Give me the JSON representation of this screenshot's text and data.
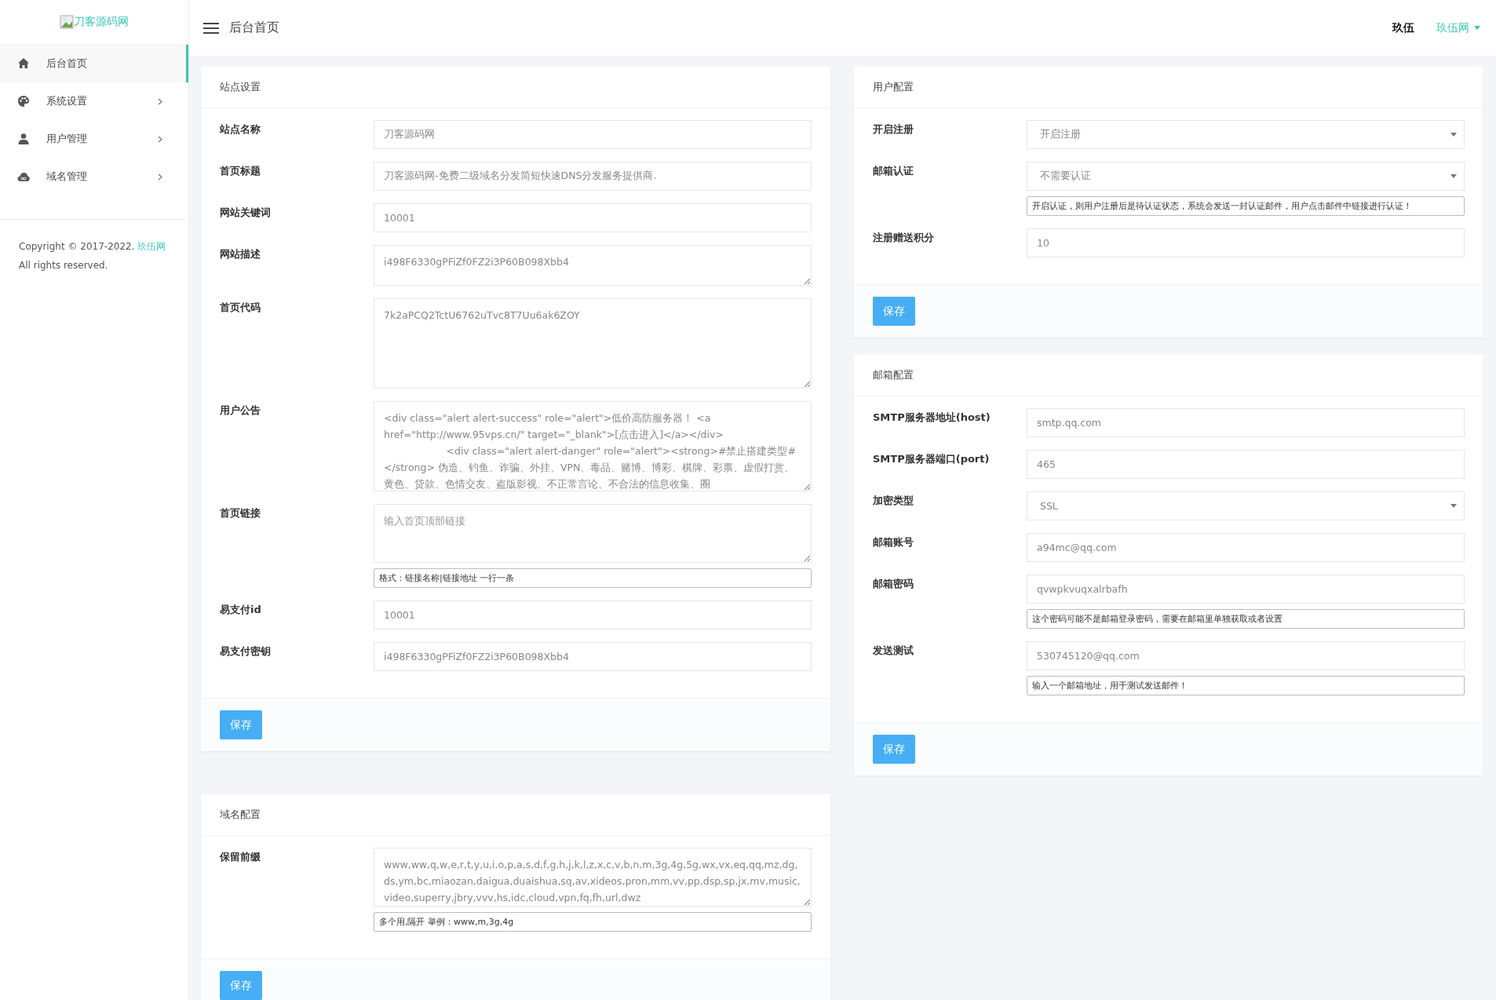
{
  "logo": {
    "alt_text": "刀客源码网"
  },
  "sidebar": {
    "items": [
      {
        "kind": "home",
        "label": "后台首页",
        "selected": true,
        "has_submenu": false
      },
      {
        "kind": "palette",
        "label": "系统设置",
        "selected": false,
        "has_submenu": true
      },
      {
        "kind": "user",
        "label": "用户管理",
        "selected": false,
        "has_submenu": true
      },
      {
        "kind": "cloud",
        "label": "域名管理",
        "selected": false,
        "has_submenu": true
      }
    ],
    "footer": {
      "copyright": "Copyright © 2017-2022.",
      "link": "玖伍网",
      "rights": "All rights reserved."
    }
  },
  "header": {
    "title": "后台首页",
    "user": "玖伍",
    "site_menu": "玖伍网"
  },
  "columns": [
    {
      "panels": [
        {
          "title": "站点设置",
          "button": "保存",
          "fields": [
            {
              "label": "站点名称",
              "kind": "input",
              "value": "刀客源码网"
            },
            {
              "label": "首页标题",
              "kind": "input",
              "value": "刀客源码网-免费二级域名分发简短快速DNS分发服务提供商."
            },
            {
              "label": "网站关键词",
              "kind": "input",
              "value": "10001"
            },
            {
              "label": "网站描述",
              "kind": "textarea",
              "value": "i498F6330gPFiZf0FZ2i3P60B098Xbb4"
            },
            {
              "label": "首页代码",
              "kind": "textarea",
              "value": "7k2aPCQ2TctU6762uTvc8T7Uu6ak6ZOY"
            },
            {
              "label": "用户公告",
              "kind": "textarea",
              "value": "<div class=\"alert alert-success\" role=\"alert\">低价高防服务器！ <a href=\"http://www.95vps.cn/\" target=\"_blank\">[点击进入]</a></div>\n                    <div class=\"alert alert-danger\" role=\"alert\"><strong>#禁止搭建类型#</strong> 伪造、钓鱼、诈骗、外挂、VPN、毒品、赌博、博彩、棋牌、彩票、虚假打赏、黄色、贷款、色情交友、盗版影视、不正常言论、不合法的信息收集、圈"
            },
            {
              "label": "首页链接",
              "kind": "textarea",
              "placeholder": "输入首页顶部链接",
              "help": "格式：链接名称|链接地址 一行一条"
            },
            {
              "label": "易支付id",
              "kind": "input",
              "value": "10001"
            },
            {
              "label": "易支付密钥",
              "kind": "input",
              "value": "i498F6330gPFiZf0FZ2i3P60B098Xbb4"
            }
          ]
        },
        {
          "title": "域名配置",
          "button": "保存",
          "fields": [
            {
              "label": "保留前缀",
              "kind": "textarea",
              "value": "www,ww,q,w,e,r,t,y,u,i,o,p,a,s,d,f,g,h,j,k,l,z,x,c,v,b,n,m,3g,4g,5g,wx,vx,eq,qq,mz,dg,ds,ym,bc,miaozan,daigua,duaishua,sq,av,xideos,pron,mm,vv,pp,dsp,sp,jx,mv,music,video,superry,jbry,vvv,hs,idc,cloud,vpn,fq,fh,url,dwz",
              "help": "多个用,隔开 举例：www,m,3g,4g"
            }
          ]
        }
      ]
    },
    {
      "panels": [
        {
          "title": "用户配置",
          "button": "保存",
          "fields": [
            {
              "label": "开启注册",
              "kind": "select",
              "value": "开启注册"
            },
            {
              "label": "邮箱认证",
              "kind": "select",
              "value": "不需要认证",
              "help": "开启认证，则用户注册后是待认证状态，系统会发送一封认证邮件，用户点击邮件中链接进行认证！"
            },
            {
              "label": "注册赠送积分",
              "kind": "input",
              "value": "10"
            }
          ]
        },
        {
          "title": "邮箱配置",
          "button": "保存",
          "fields": [
            {
              "label": "SMTP服务器地址(host)",
              "kind": "input",
              "value": "smtp.qq.com"
            },
            {
              "label": "SMTP服务器端口(port)",
              "kind": "input",
              "value": "465"
            },
            {
              "label": "加密类型",
              "kind": "select",
              "value": "SSL"
            },
            {
              "label": "邮箱账号",
              "kind": "input",
              "value": "a94mc@qq.com"
            },
            {
              "label": "邮箱密码",
              "kind": "input",
              "value": "qvwpkvuqxalrbafh",
              "help": "这个密码可能不是邮箱登录密码，需要在邮箱里单独获取或者设置"
            },
            {
              "label": "发送测试",
              "kind": "input",
              "value": "530745120@qq.com",
              "help": "输入一个邮箱地址，用于测试发送邮件！"
            }
          ]
        }
      ]
    }
  ]
}
